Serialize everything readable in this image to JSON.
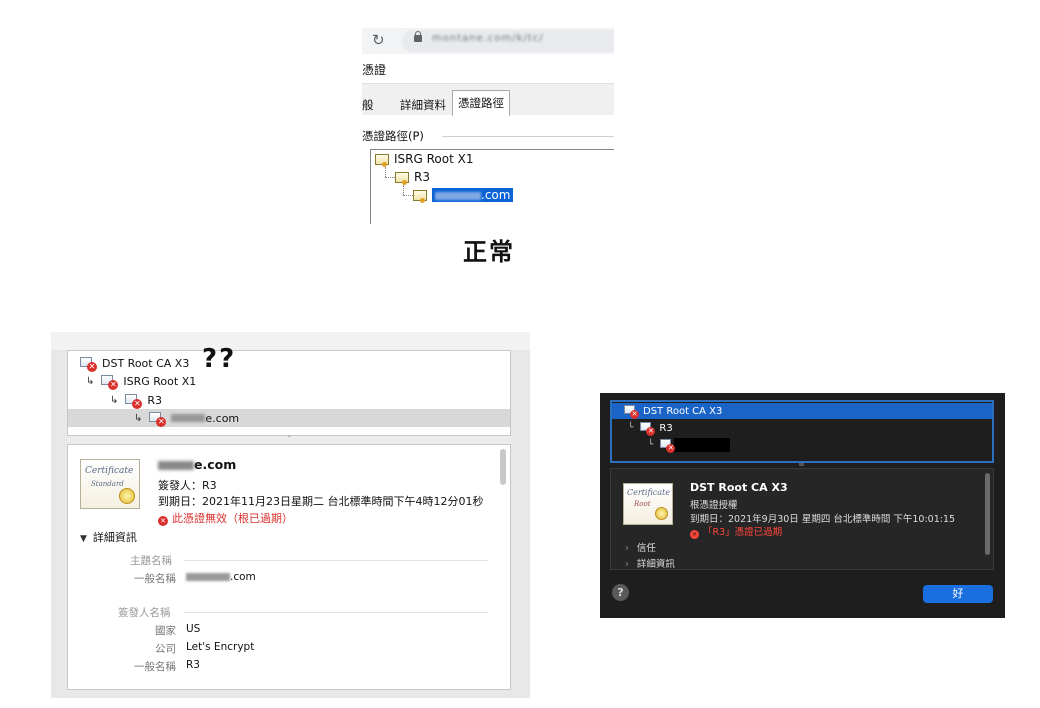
{
  "windows_panel": {
    "url": "montane.com/k/tc/",
    "dialog_title": "憑證",
    "tabs": [
      {
        "label": "般"
      },
      {
        "label": "詳細資料"
      },
      {
        "label": "憑證路徑"
      }
    ],
    "group_label": "憑證路徑(P)",
    "tree": [
      {
        "label": "ISRG Root X1"
      },
      {
        "label": "R3"
      },
      {
        "label": ".com"
      }
    ]
  },
  "caption_normal": "正常",
  "caption_question": "??",
  "mac_light": {
    "tree": [
      {
        "label": "DST Root CA X3"
      },
      {
        "label": "ISRG Root X1"
      },
      {
        "label": "R3"
      },
      {
        "label": "e.com"
      }
    ],
    "cert_art": {
      "title": "Certificate",
      "subtitle": "Standard"
    },
    "cert_name": "e.com",
    "issuer": "簽發人：R3",
    "expiry": "到期日：2021年11月23日星期二 台北標準時間下午4時12分01秒",
    "status": "此憑證無效（根已過期）",
    "details_label": "詳細資訊",
    "subject_heading": "主題名稱",
    "subject_rows": [
      {
        "key": "一般名稱",
        "value": ".com"
      }
    ],
    "issuer_heading": "簽發人名稱",
    "issuer_rows": [
      {
        "key": "國家",
        "value": "US"
      },
      {
        "key": "公司",
        "value": "Let's Encrypt"
      },
      {
        "key": "一般名稱",
        "value": "R3"
      }
    ]
  },
  "mac_dark": {
    "tree": [
      {
        "label": "DST Root CA X3"
      },
      {
        "label": "R3"
      }
    ],
    "cert_art": {
      "title": "Certificate",
      "subtitle": "Root"
    },
    "cert_name": "DST Root CA X3",
    "cert_type": "根憑證授權",
    "expiry": "到期日：2021年9月30日 星期四 台北標準時間 下午10:01:15",
    "status": "「R3」憑證已過期",
    "sections": [
      {
        "label": "信任"
      },
      {
        "label": "詳細資訊"
      }
    ],
    "help_label": "?",
    "ok_label": "好"
  },
  "colors": {
    "selection_blue": "#0a64d6",
    "error_red": "#d9302c",
    "dark_accent": "#1a6fe0"
  }
}
